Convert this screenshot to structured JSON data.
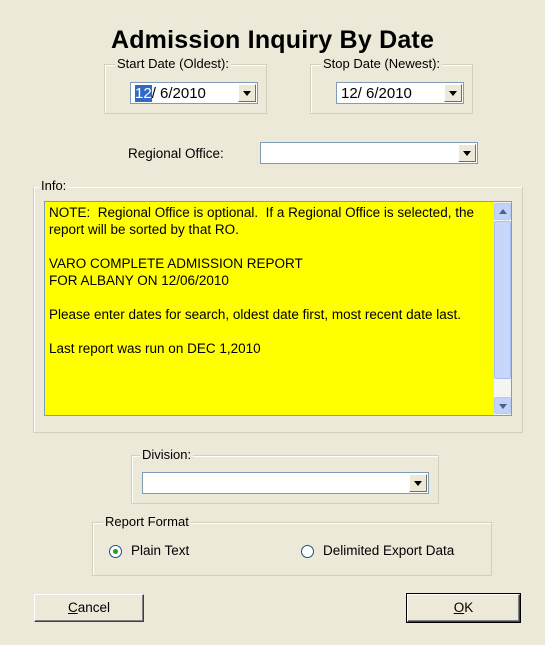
{
  "title": "Admission Inquiry By Date",
  "start_date": {
    "label": "Start Date (Oldest):",
    "selected": "12",
    "rest": "/  6/2010"
  },
  "stop_date": {
    "label": "Stop Date (Newest):",
    "value": "12/  6/2010"
  },
  "regional_office": {
    "label": "Regional Office:",
    "value": ""
  },
  "info": {
    "label": "Info:",
    "text": "NOTE:  Regional Office is optional.  If a Regional Office is selected, the report will be sorted by that RO.\n\nVARO COMPLETE ADMISSION REPORT\nFOR ALBANY ON 12/06/2010\n\nPlease enter dates for search, oldest date first, most recent date last.\n\nLast report was run on DEC 1,2010"
  },
  "division": {
    "label": "Division:",
    "value": ""
  },
  "report_format": {
    "label": "Report Format",
    "plain_text": "Plain Text",
    "delimited": "Delimited Export Data",
    "selected": "plain_text"
  },
  "buttons": {
    "cancel_mnemonic": "C",
    "cancel_rest": "ancel",
    "ok_mnemonic": "O",
    "ok_rest": "K"
  },
  "colors": {
    "info_background": "#ffff00",
    "dialog_background": "#ece9d8",
    "selection": "#316ac5"
  }
}
